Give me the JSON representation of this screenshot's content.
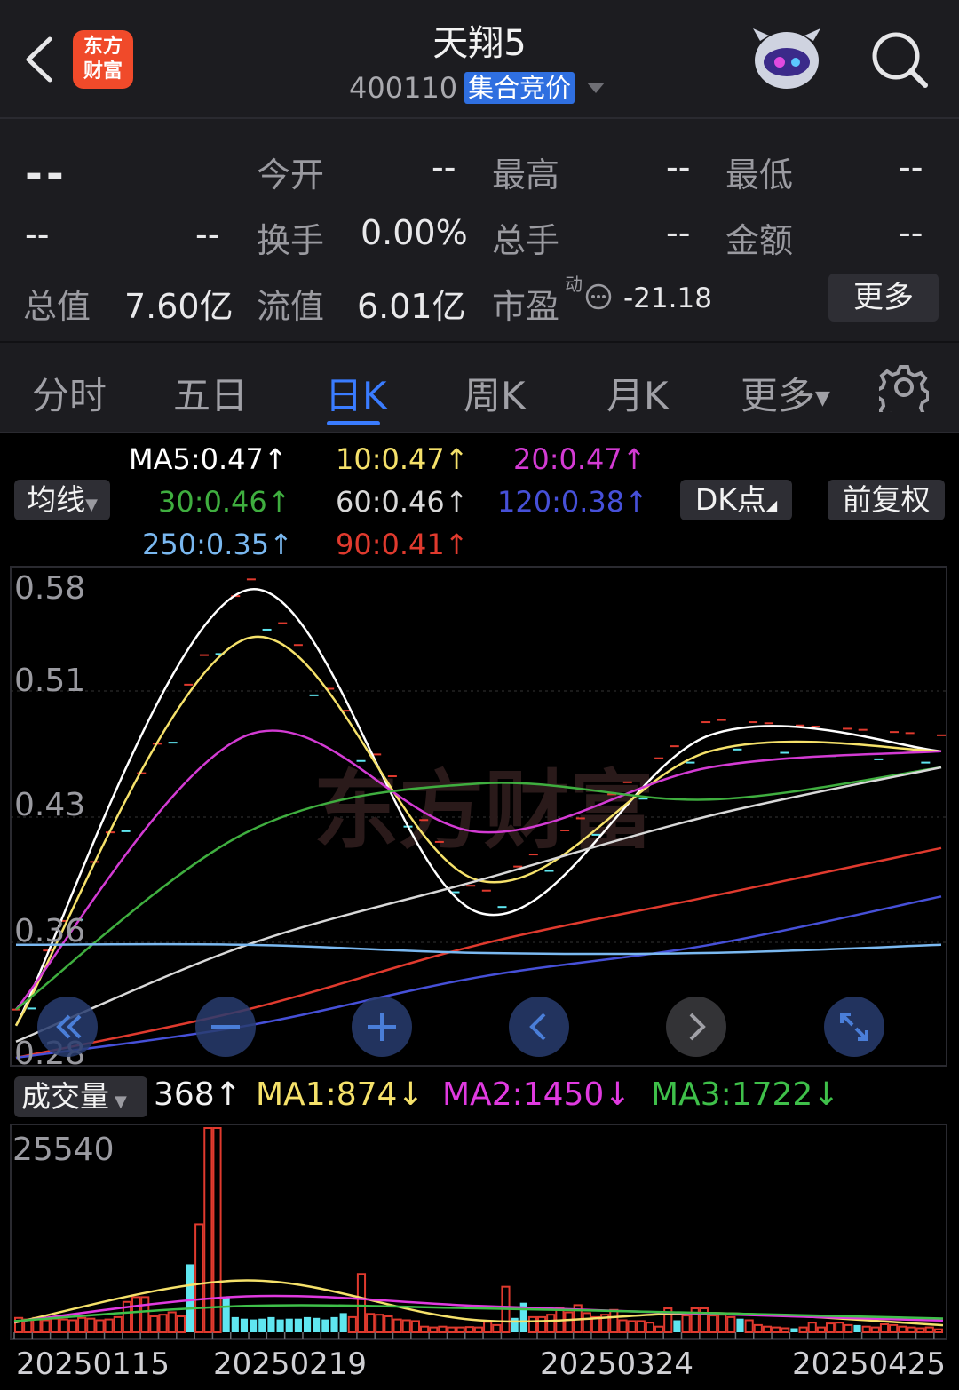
{
  "header": {
    "back_icon": "chevron-left-icon",
    "app_logo_text": "东方财富",
    "stock_name": "天翔5",
    "stock_code": "400110",
    "auction_badge": "集合竞价",
    "robot_icon": "robot-avatar-icon",
    "search_icon": "search-icon"
  },
  "quote": {
    "price": "--",
    "change": "--",
    "change_pct": "--",
    "open_label": "今开",
    "open_value": "--",
    "high_label": "最高",
    "high_value": "--",
    "low_label": "最低",
    "low_value": "--",
    "turnover_label": "换手",
    "turnover_value": "0.00%",
    "volume_label": "总手",
    "volume_value": "--",
    "amount_label": "金额",
    "amount_value": "--",
    "total_cap_label": "总值",
    "total_cap_value": "7.60亿",
    "float_cap_label": "流值",
    "float_cap_value": "6.01亿",
    "pe_label": "市盈",
    "pe_sup": "动",
    "pe_value": "-21.18",
    "more_button": "更多"
  },
  "tabs": {
    "items": [
      "分时",
      "五日",
      "日K",
      "周K",
      "月K",
      "更多"
    ],
    "active": "日K",
    "settings_icon": "gear-icon"
  },
  "indicators": {
    "ma_select": "均线",
    "ma5": "MA5:0.47↑",
    "ma10": "10:0.47↑",
    "ma20": "20:0.47↑",
    "ma30": "30:0.46↑",
    "ma60": "60:0.46↑",
    "ma120": "120:0.38↑",
    "ma250": "250:0.35↑",
    "ma90": "90:0.41↑",
    "dk_button": "DK点",
    "adjust_button": "前复权",
    "colors": {
      "ma5": "#ffffff",
      "ma10": "#f5e16a",
      "ma20": "#d33bd3",
      "ma30": "#3fae3f",
      "ma60": "#d8d8d8",
      "ma120": "#4650d8",
      "ma250": "#7ab8f0",
      "ma90": "#e03a2e"
    }
  },
  "price_axis": [
    "0.58",
    "0.51",
    "0.43",
    "0.36",
    "0.28"
  ],
  "chart_controls": [
    "rewind-icon",
    "zoom-out-icon",
    "zoom-in-icon",
    "prev-icon",
    "next-icon",
    "fullscreen-icon"
  ],
  "volume": {
    "select_label": "成交量",
    "current": "368↑",
    "ma1": "MA1:874↓",
    "ma2": "MA2:1450↓",
    "ma3": "MA3:1722↓",
    "axis_max": "25540"
  },
  "dates": [
    "20250115",
    "20250219",
    "20250324",
    "20250425"
  ],
  "chart_data": [
    {
      "type": "line",
      "title": "日K",
      "x": [
        "20250115",
        "20250219",
        "20250324",
        "20250425"
      ],
      "ylim": [
        0.28,
        0.58
      ],
      "y_ticks": [
        0.58,
        0.51,
        0.43,
        0.36,
        0.28
      ],
      "series": [
        {
          "name": "MA5",
          "values": [
            0.3,
            0.57,
            0.37,
            0.48,
            0.47
          ]
        },
        {
          "name": "10",
          "values": [
            0.3,
            0.54,
            0.39,
            0.47,
            0.47
          ]
        },
        {
          "name": "20",
          "values": [
            0.31,
            0.48,
            0.42,
            0.46,
            0.47
          ]
        },
        {
          "name": "30",
          "values": [
            0.31,
            0.42,
            0.45,
            0.44,
            0.46
          ]
        },
        {
          "name": "60",
          "values": [
            0.29,
            0.35,
            0.39,
            0.43,
            0.46
          ]
        },
        {
          "name": "90",
          "values": [
            0.28,
            0.31,
            0.35,
            0.38,
            0.41
          ]
        },
        {
          "name": "120",
          "values": [
            0.28,
            0.3,
            0.33,
            0.35,
            0.38
          ]
        },
        {
          "name": "250",
          "values": [
            0.35,
            0.35,
            0.345,
            0.345,
            0.35
          ]
        }
      ]
    },
    {
      "type": "bar",
      "title": "成交量",
      "ylim": [
        0,
        25540
      ],
      "values": [
        1800,
        1600,
        1800,
        1500,
        1700,
        1600,
        1500,
        1800,
        1700,
        1500,
        1600,
        1900,
        3800,
        4400,
        4400,
        2000,
        2200,
        2500,
        2000,
        8500,
        13500,
        25540,
        25540,
        4400,
        1900,
        1700,
        1600,
        1700,
        1900,
        1600,
        1700,
        1700,
        1900,
        1800,
        1600,
        1900,
        2400,
        1900,
        7300,
        2300,
        2200,
        2000,
        1600,
        1500,
        1400,
        700,
        600,
        700,
        600,
        600,
        650,
        600,
        1300,
        900,
        5700,
        1800,
        3700,
        1900,
        1900,
        2200,
        3000,
        2500,
        3400,
        2400,
        1900,
        2200,
        2800,
        1500,
        1400,
        1400,
        1200,
        700,
        3000,
        1500,
        2100,
        3000,
        3000,
        2100,
        2200,
        1900,
        1700,
        1500,
        900,
        700,
        600,
        500,
        500,
        600,
        1200,
        600,
        1100,
        1200,
        900,
        900,
        700,
        600,
        1000,
        900,
        700,
        600,
        500,
        600,
        368
      ],
      "series": [
        {
          "name": "MA1",
          "values": [
            1200,
            6500,
            1500,
            2400,
            874
          ]
        },
        {
          "name": "MA2",
          "values": [
            1300,
            4500,
            3300,
            2300,
            1450
          ]
        },
        {
          "name": "MA3",
          "values": [
            1400,
            3300,
            3000,
            2400,
            1722
          ]
        }
      ]
    }
  ]
}
